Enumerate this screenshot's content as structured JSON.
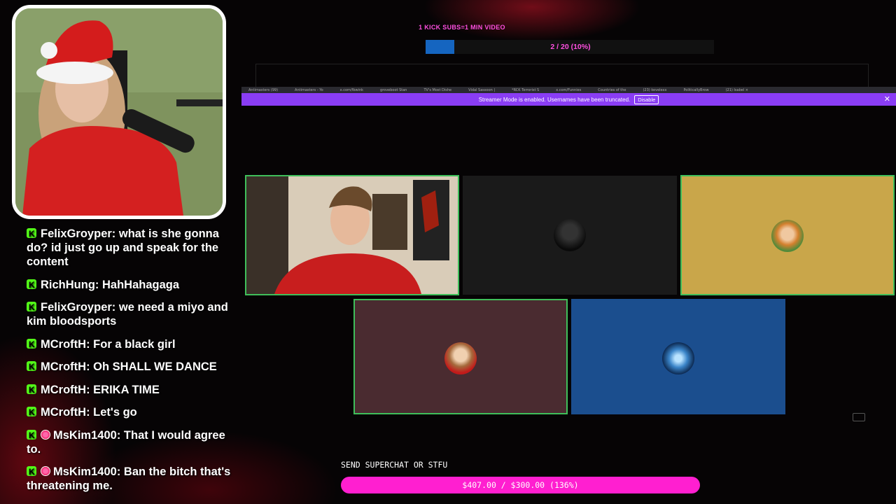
{
  "goal": {
    "title": "1 KICK SUBS=1 MIN VIDEO",
    "progress_text": "2 / 20 (10%)",
    "progress_fraction": 0.1,
    "bar_color": "#1565c0"
  },
  "browser": {
    "tabs": [
      "Antimasters (99)",
      "Antimasters - Yo",
      "x.com/fbwink",
      "groveboot Stan",
      "TV's Most Dishe",
      "Vidal Sassoon |",
      "*RCK Terrorist S",
      "x.com/Funnies",
      "Countries of the",
      "(23) kevelexx",
      "PoliticallyBrow",
      "(21) Isabel ×"
    ],
    "streamer_mode_text": "Streamer Mode is enabled. Usernames have been truncated.",
    "disable_label": "Disable",
    "close_label": "✕",
    "banner_color": "#8a3df5"
  },
  "chat": {
    "messages": [
      {
        "user": "FelixGroyper",
        "text": "what is she gonna do? id just go up and speak for the content",
        "badge": "kick"
      },
      {
        "user": "RichHung",
        "text": "HahHahagaga",
        "badge": "kick"
      },
      {
        "user": "FelixGroyper",
        "text": "we need a miyo and kim bloodsports",
        "badge": "kick"
      },
      {
        "user": "MCroftH",
        "text": "For a black girl",
        "badge": "kick"
      },
      {
        "user": "MCroftH",
        "text": "Oh SHALL WE DANCE",
        "badge": "kick"
      },
      {
        "user": "MCroftH",
        "text": "ERIKA TIME",
        "badge": "kick"
      },
      {
        "user": "MCroftH",
        "text": "Let's go",
        "badge": "kick"
      },
      {
        "user": "MsKim1400",
        "text": "That I would agree to.",
        "badge": "kick+sub"
      },
      {
        "user": "MsKim1400",
        "text": "Ban the bitch that's threatening me.",
        "badge": "kick+sub"
      }
    ]
  },
  "tiles": {
    "colors": {
      "dark": "#1a1a1a",
      "gold": "#c9a64a",
      "maroon": "#4a2b30",
      "blue": "#1b4e8e",
      "active_border": "#3fbf5a"
    }
  },
  "superchat": {
    "label": "SEND SUPERCHAT OR STFU",
    "progress_text": "$407.00 / $300.00 (136%)",
    "bar_color": "#ff1fd0"
  }
}
